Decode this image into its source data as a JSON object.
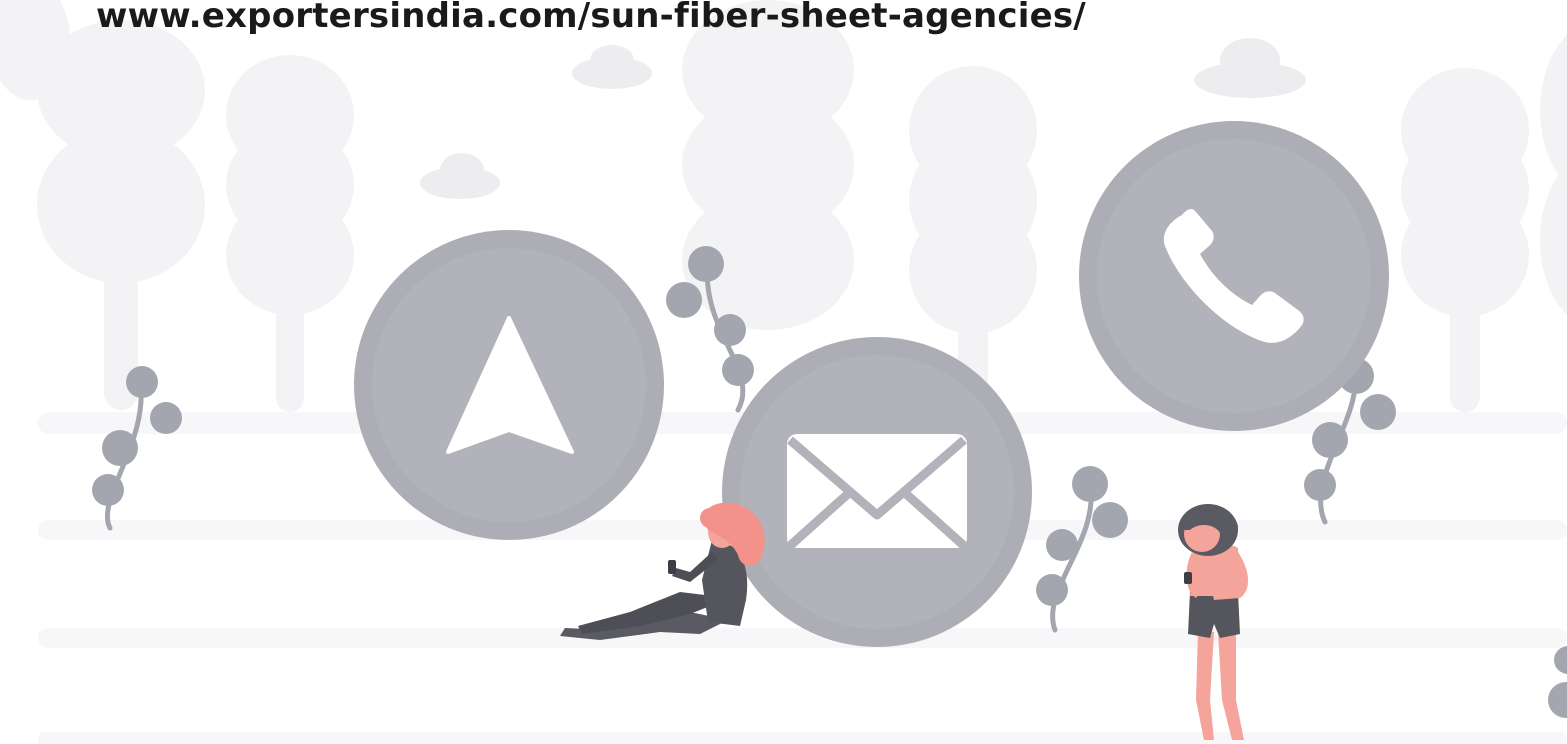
{
  "banner": {
    "url": "www.exportersindia.com/sun-fiber-sheet-agencies/"
  },
  "icons": {
    "location": "navigation-arrow-icon",
    "email": "envelope-icon",
    "phone": "phone-handset-icon"
  },
  "colors": {
    "icon_circle": "#adadb6",
    "icon_circle_inner": "#b2b2ba",
    "plant": "#a3a5ae",
    "tree": "#f2f2f4",
    "hair": "#f2928a",
    "skin": "#f5a49b",
    "clothing": "#5a5a62"
  }
}
